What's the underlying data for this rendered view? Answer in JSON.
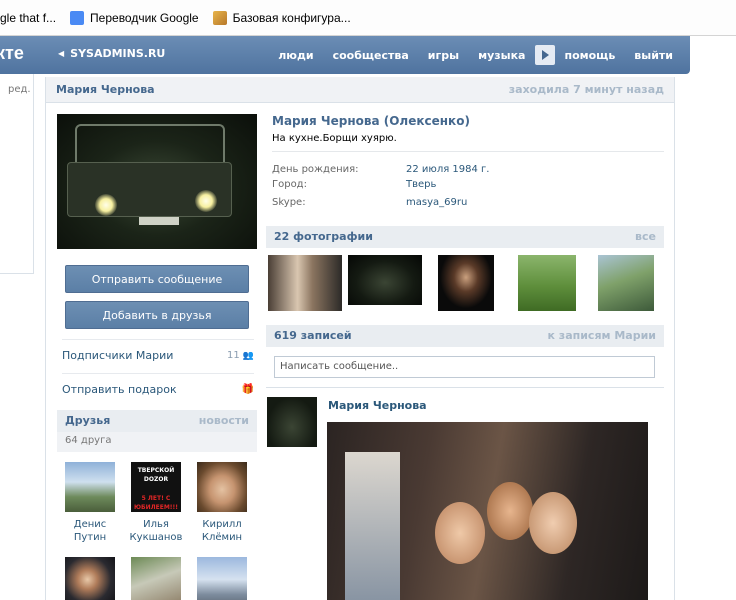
{
  "browser": {
    "bookmarks": [
      {
        "label": "gle that f...",
        "icon": "google-icon",
        "color": "#3b7de0"
      },
      {
        "label": "Переводчик Google",
        "icon": "google-translate-icon",
        "color": "#4a8af4"
      },
      {
        "label": "Базовая конфигура...",
        "icon": "bookmark-icon",
        "color": "#d9a441"
      }
    ]
  },
  "header": {
    "logo": "кте",
    "back_label": "SYSADMINS.RU",
    "nav": [
      "люди",
      "сообщества",
      "игры",
      "музыка",
      "помощь",
      "выйти"
    ]
  },
  "sidebar": {
    "edit_label": "ред."
  },
  "profile": {
    "title_name": "Мария Чернова",
    "last_seen": "заходила 7 минут назад",
    "full_name": "Мария Чернова (Олексенко)",
    "status": "На кухне.Борщи хуярю.",
    "info": [
      {
        "label": "День рождения:",
        "value": "22 июля 1984 г."
      },
      {
        "label": "Город:",
        "value": "Тверь"
      },
      {
        "label": "Skype:",
        "value": "masya_69ru"
      }
    ],
    "buttons": {
      "send_message": "Отправить сообщение",
      "add_friend": "Добавить в друзья"
    },
    "menu": {
      "subscribers": "Подписчики Марии",
      "subscribers_count": "11",
      "gift": "Отправить подарок"
    },
    "friends": {
      "title": "Друзья",
      "news_link": "новости",
      "count": "64 друга",
      "people": [
        {
          "first": "Денис",
          "last": "Путин"
        },
        {
          "first": "Илья",
          "last": "Кукшанов"
        },
        {
          "first": "Кирилл",
          "last": "Клёмин"
        }
      ],
      "badge_text": "ТВЕРСКОЙ DOZOR",
      "badge_sub": "5 ЛЕТ! С ЮБИЛЕЕМ!!!"
    },
    "photos": {
      "title": "22 фотографии",
      "link": "все"
    },
    "wall": {
      "title": "619 записей",
      "link": "к записям Марии",
      "placeholder": "Написать сообщение..",
      "post_author": "Мария Чернова"
    }
  },
  "colors": {
    "header": "#597da3",
    "link": "#2b587a",
    "title": "#45688e",
    "muted": "#a9b9c9"
  }
}
